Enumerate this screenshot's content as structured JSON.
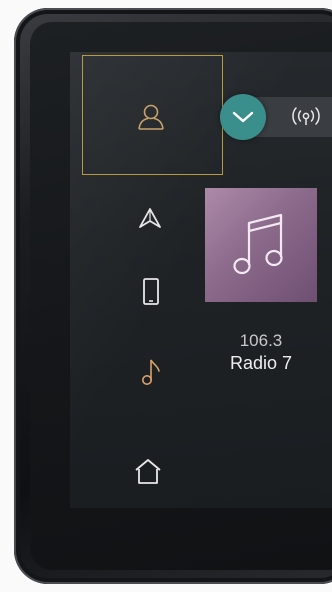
{
  "nav": {
    "items": [
      {
        "name": "profile",
        "icon": "user-icon",
        "color": "#c9a26a"
      },
      {
        "name": "navigation",
        "icon": "navigation-arrow-icon",
        "color": "#e8e8e8"
      },
      {
        "name": "phone",
        "icon": "smartphone-icon",
        "color": "#e8e8e8"
      },
      {
        "name": "media",
        "icon": "music-note-icon",
        "color": "#d9a06a"
      },
      {
        "name": "home",
        "icon": "home-icon",
        "color": "#e8e8e8"
      }
    ],
    "selection_frame_color": "#b99a3e"
  },
  "toggle": {
    "knob_icon": "chevron-down-icon",
    "knob_color": "#3a8f8d",
    "signal_icon": "radio-signal-icon"
  },
  "now_playing": {
    "album_icon": "music-notes-icon",
    "frequency": "106.3",
    "station": "Radio 7"
  }
}
